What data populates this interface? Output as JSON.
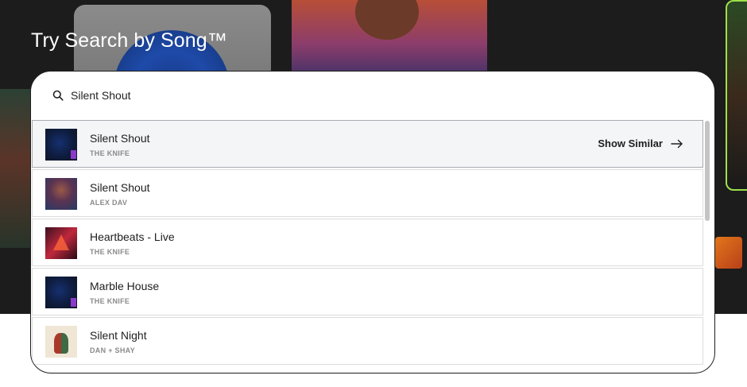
{
  "hero": {
    "title": "Try Search by Song™"
  },
  "search": {
    "query": "Silent Shout",
    "icon": "search-icon"
  },
  "results": [
    {
      "title": "Silent Shout",
      "artist": "THE KNIFE",
      "active": true,
      "action_label": "Show Similar",
      "action_icon": "arrow-right-icon"
    },
    {
      "title": "Silent Shout",
      "artist": "ALEX DAV"
    },
    {
      "title": "Heartbeats - Live",
      "artist": "THE KNIFE"
    },
    {
      "title": "Marble House",
      "artist": "THE KNIFE"
    },
    {
      "title": "Silent Night",
      "artist": "DAN + SHAY"
    }
  ],
  "colors": {
    "background_dark": "#1c1c1c",
    "panel_border": "#1e1e1e",
    "active_row": "#f4f5f7",
    "artist_text": "#8a8a8a"
  }
}
